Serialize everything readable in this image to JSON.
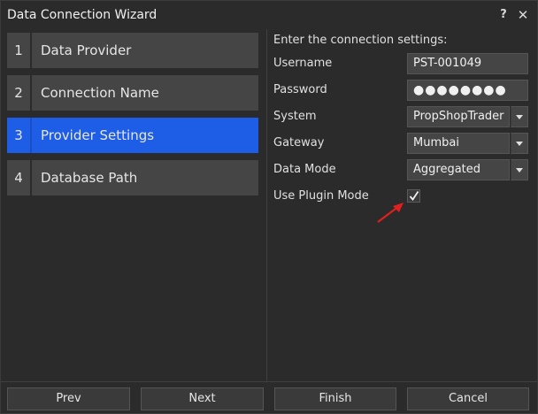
{
  "window": {
    "title": "Data Connection Wizard",
    "help_label": "?",
    "close_label": "✕"
  },
  "steps": [
    {
      "num": "1",
      "label": "Data Provider",
      "active": false
    },
    {
      "num": "2",
      "label": "Connection Name",
      "active": false
    },
    {
      "num": "3",
      "label": "Provider Settings",
      "active": true
    },
    {
      "num": "4",
      "label": "Database Path",
      "active": false
    }
  ],
  "settings": {
    "prompt": "Enter the connection settings:",
    "username": {
      "label": "Username",
      "value": "PST-001049"
    },
    "password": {
      "label": "Password",
      "value": "●●●●●●●●"
    },
    "system": {
      "label": "System",
      "value": "PropShopTrader"
    },
    "gateway": {
      "label": "Gateway",
      "value": "Mumbai"
    },
    "data_mode": {
      "label": "Data Mode",
      "value": "Aggregated"
    },
    "plugin_mode": {
      "label": "Use Plugin Mode",
      "checked": true
    }
  },
  "footer": {
    "prev_label": "Prev",
    "next_label": "Next",
    "finish_label": "Finish",
    "cancel_label": "Cancel"
  },
  "colors": {
    "accent": "#1e5de6",
    "annotation_arrow": "#e02020"
  }
}
